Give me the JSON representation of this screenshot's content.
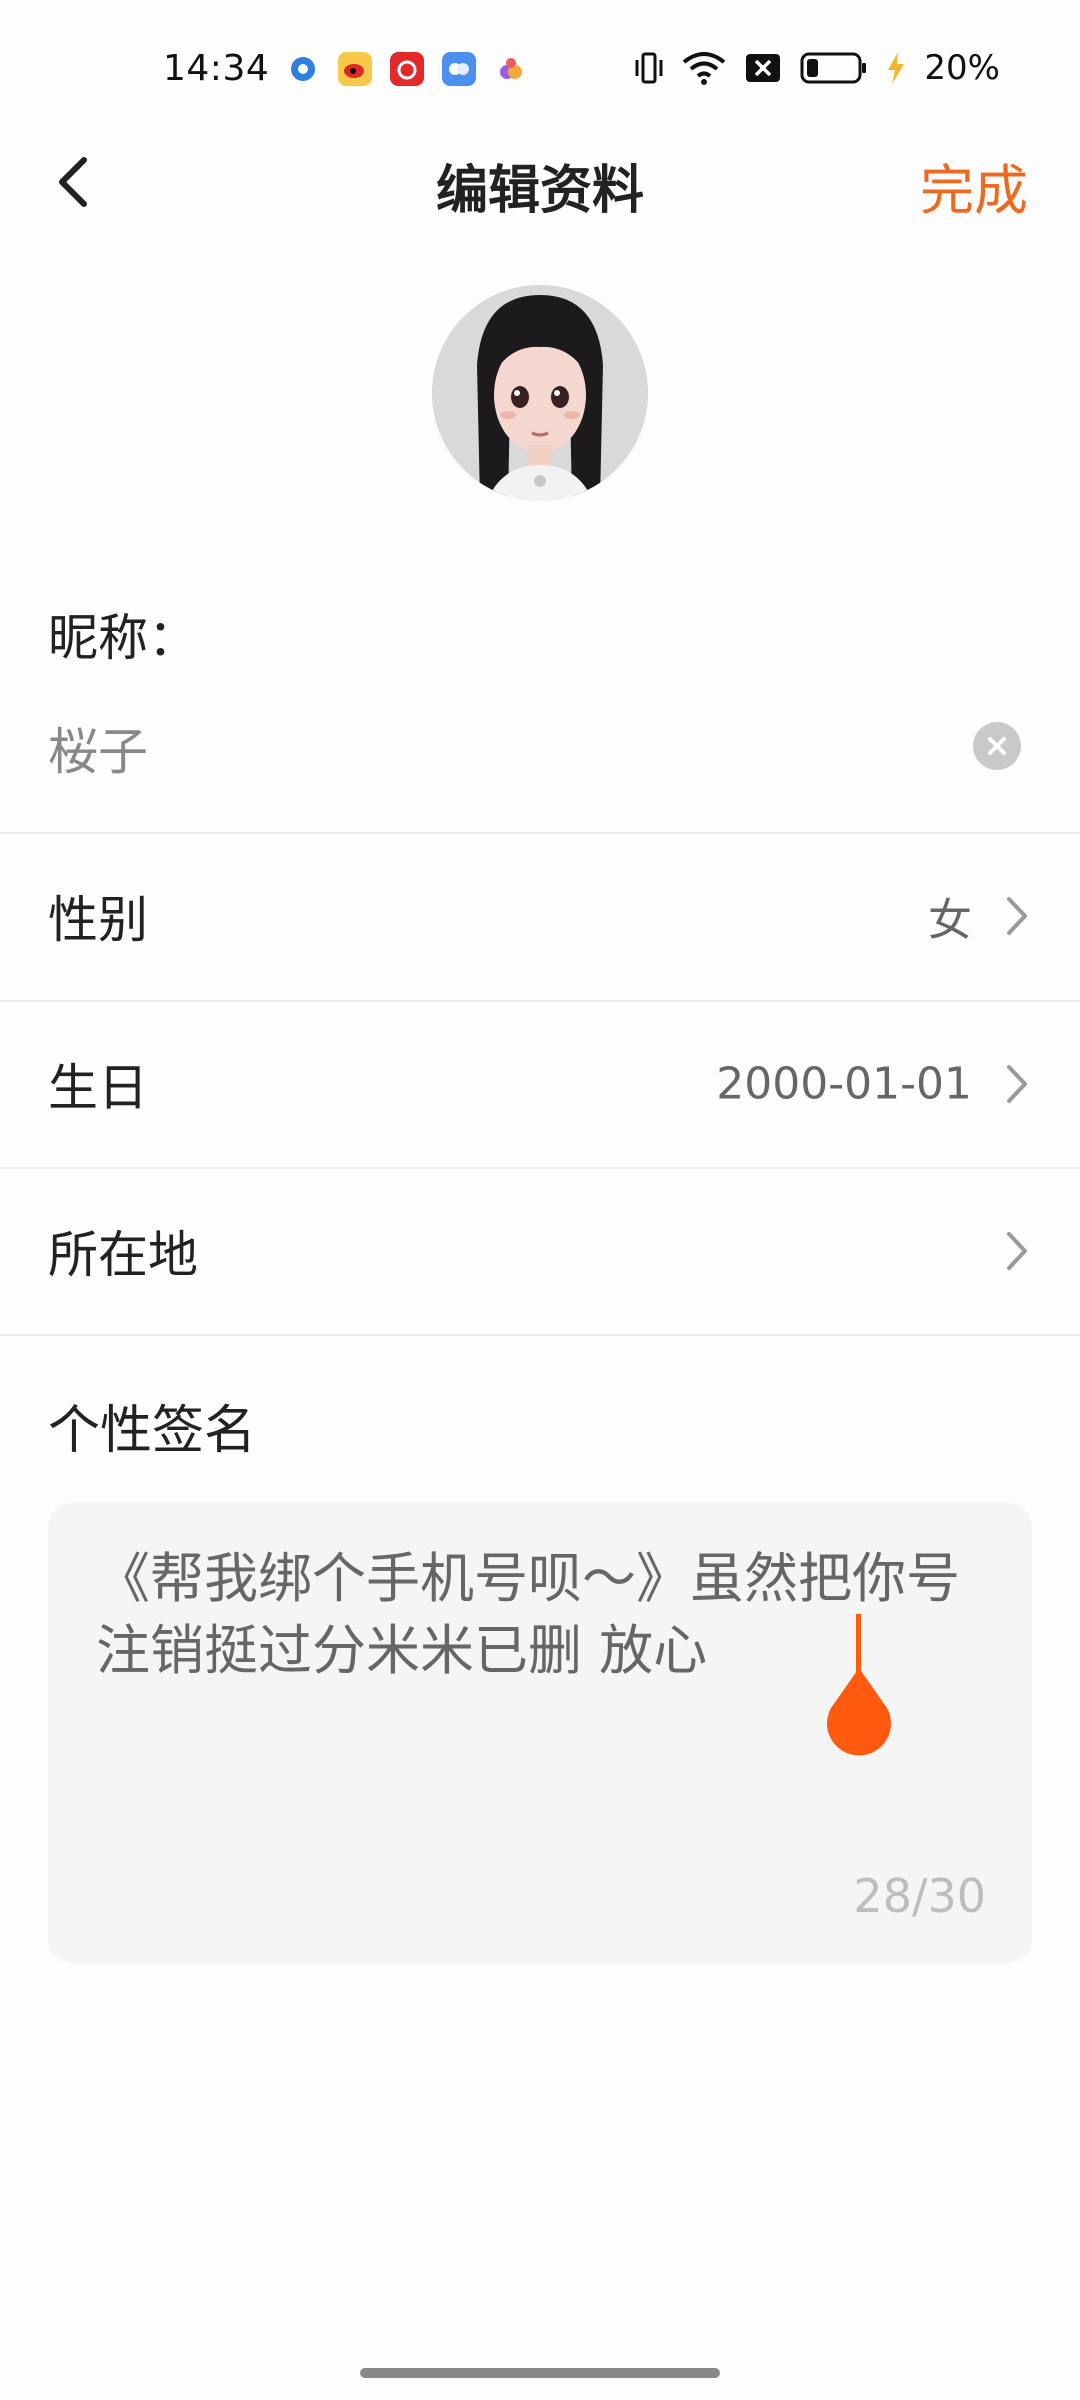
{
  "status_bar": {
    "time": "14:34",
    "battery_pct": "20%",
    "icons": [
      "app-circle-icon",
      "weibo-icon",
      "netease-music-icon",
      "chat-bubbles-icon",
      "colorful-app-icon",
      "vibrate-icon",
      "wifi-icon",
      "no-sim-icon",
      "battery-icon",
      "charging-icon"
    ]
  },
  "header": {
    "title": "编辑资料",
    "done_label": "完成"
  },
  "nickname": {
    "label": "昵称：",
    "value": "桜子"
  },
  "rows": {
    "gender": {
      "label": "性别",
      "value": "女"
    },
    "birthday": {
      "label": "生日",
      "value": "2000-01-01"
    },
    "location": {
      "label": "所在地",
      "value": ""
    }
  },
  "signature": {
    "label": "个性签名",
    "text": "《帮我绑个手机号呗～》虽然把你号注销挺过分米米已删 放心",
    "count": "28/30"
  },
  "colors": {
    "accent": "#ef6a1f",
    "cursor": "#ff5a10"
  }
}
